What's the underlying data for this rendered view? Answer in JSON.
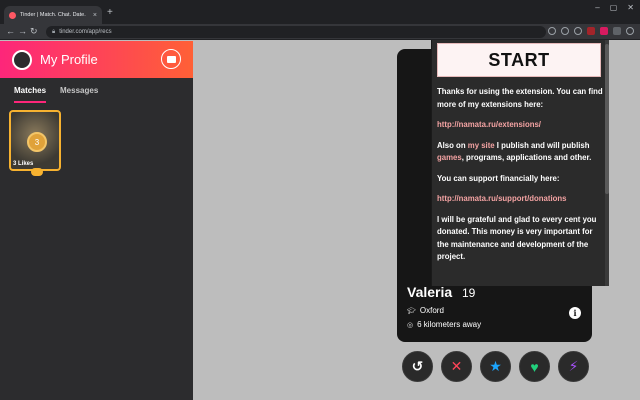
{
  "browser": {
    "tab_title": "Tinder | Match. Chat. Date.",
    "tab_close": "×",
    "new_tab": "+",
    "url": "tinder.com/app/recs",
    "window_controls": [
      "–",
      "▢",
      "✕"
    ]
  },
  "sidebar": {
    "profile_name": "My Profile",
    "tabs": [
      {
        "label": "Matches",
        "active": true
      },
      {
        "label": "Messages",
        "active": false
      }
    ],
    "likes": {
      "count": "3",
      "label": "3 Likes"
    }
  },
  "card": {
    "name": "Valeria",
    "age": "19",
    "location": "Oxford",
    "distance": "6 kilometers away",
    "info": "i"
  },
  "actions": [
    {
      "name": "rewind",
      "glyph": "↺",
      "color": "#ffffff"
    },
    {
      "name": "nope",
      "glyph": "✕",
      "color": "#ff4458"
    },
    {
      "name": "super-like",
      "glyph": "★",
      "color": "#1ca4fc"
    },
    {
      "name": "like",
      "glyph": "♥",
      "color": "#21d07c"
    },
    {
      "name": "boost",
      "glyph": "⚡",
      "color": "#a34ff5"
    }
  ],
  "popup": {
    "start_label": "START",
    "p1": "Thanks for using the extension. You can find more of my extensions here:",
    "link1": "http://namata.ru/extensions/",
    "p2_a": "Also on ",
    "p2_link1": "my site",
    "p2_b": " I publish and will publish ",
    "p2_link2": "games",
    "p2_c": ", programs, applications and other.",
    "p3": "You can support financially here:",
    "link2": "http://namata.ru/support/donations",
    "p4": "I will be grateful and glad to every cent you donated. This money is very important for the maintenance and development of the project."
  },
  "colors": {
    "brand_gradient_start": "#fd267a",
    "brand_gradient_end": "#ff6036",
    "gold": "#f7b230"
  }
}
